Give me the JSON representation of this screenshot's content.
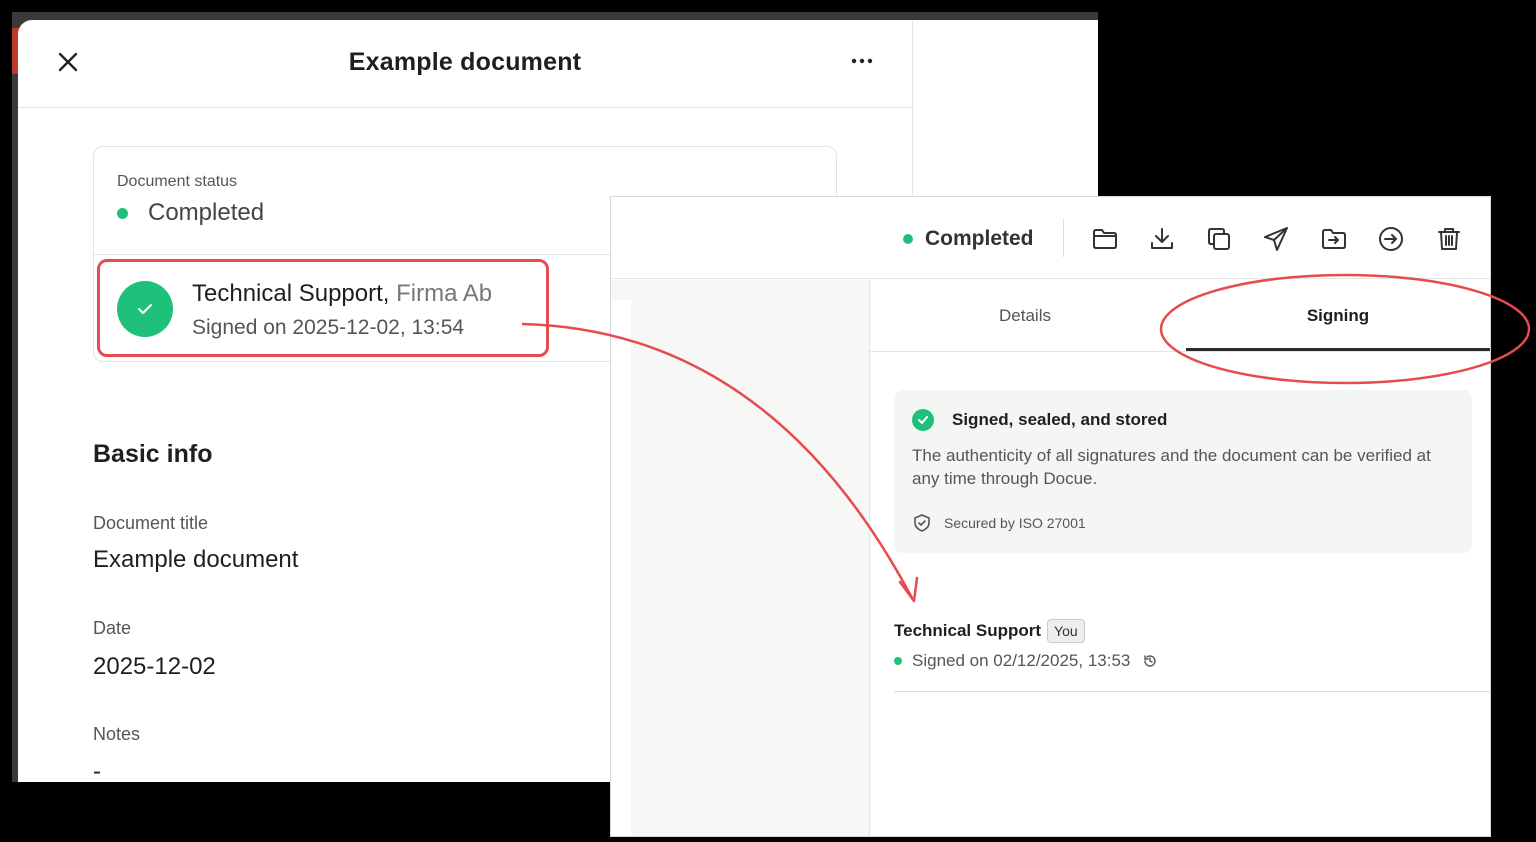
{
  "left_panel": {
    "title": "Example document",
    "status_label": "Document status",
    "status_value": "Completed",
    "signer": {
      "name": "Technical Support,",
      "company": "Firma Ab",
      "signed_text": "Signed on 2025-12-02, 13:54"
    },
    "basic_info_heading": "Basic info",
    "fields": [
      {
        "label": "Document title",
        "value": "Example document"
      },
      {
        "label": "Date",
        "value": "2025-12-02"
      },
      {
        "label": "Notes",
        "value": "-"
      }
    ]
  },
  "right_panel": {
    "toolbar_status": "Completed",
    "toolbar_icons": [
      "folder-icon",
      "download-icon",
      "copy-icon",
      "send-icon",
      "move-to-folder-icon",
      "sign-in-icon",
      "trash-icon"
    ],
    "tabs": [
      {
        "label": "Details",
        "active": false
      },
      {
        "label": "Signing",
        "active": true
      }
    ],
    "info_card": {
      "title": "Signed, sealed, and stored",
      "description": "The authenticity of all signatures and the document can be verified at any time through Docue.",
      "footer": "Secured by ISO 27001"
    },
    "signer": {
      "name": "Technical Support",
      "badge": "You",
      "signed_text": "Signed on 02/12/2025, 13:53"
    }
  },
  "colors": {
    "status_green": "#1ec07a",
    "annotation_red": "#e64b50"
  }
}
